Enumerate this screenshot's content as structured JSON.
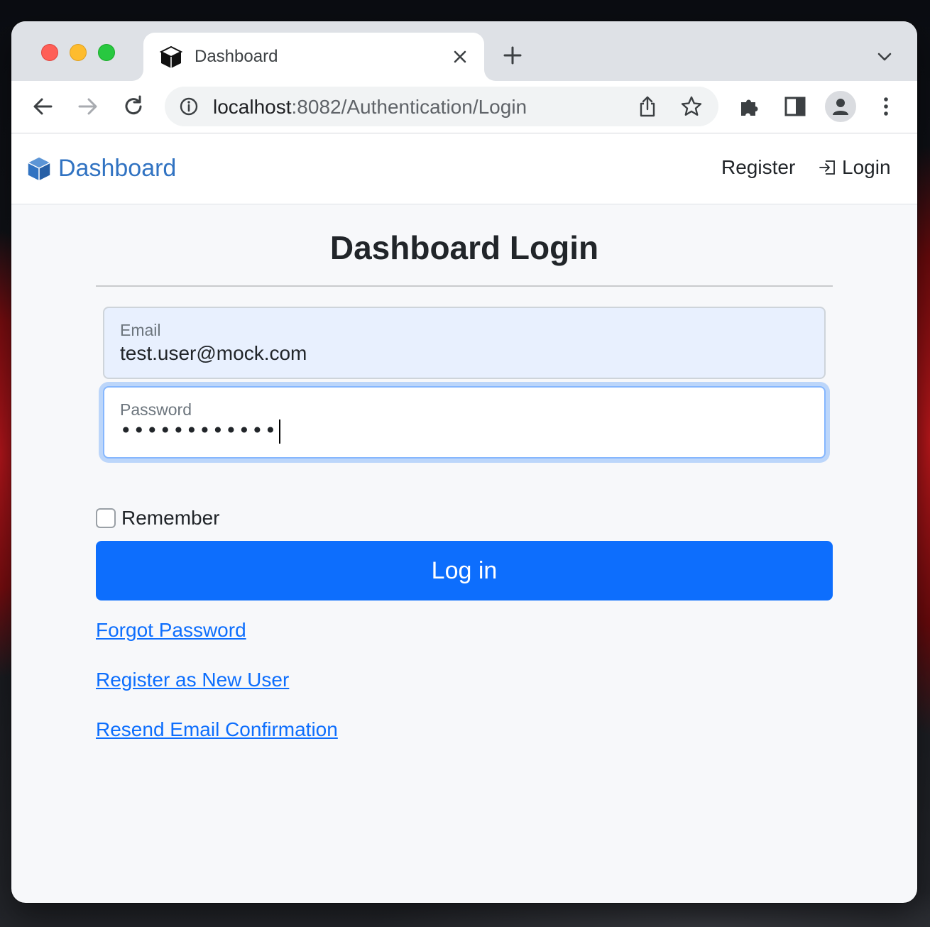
{
  "browser": {
    "tab": {
      "title": "Dashboard"
    },
    "omnibox": {
      "host": "localhost",
      "rest": ":8082/Authentication/Login"
    }
  },
  "navbar": {
    "brand": "Dashboard",
    "register": "Register",
    "login": "Login"
  },
  "login_form": {
    "title": "Dashboard Login",
    "email_label": "Email",
    "email_value": "test.user@mock.com",
    "password_label": "Password",
    "password_masked": "••••••••••••",
    "remember_label": "Remember",
    "submit_label": "Log in",
    "links": {
      "forgot": "Forgot Password",
      "register": "Register as New User",
      "resend": "Resend Email Confirmation"
    }
  },
  "colors": {
    "brand": "#3173c2",
    "primary": "#0d6efd",
    "autofill_bg": "#e8f0fe"
  },
  "icons": {
    "favicon": "box-icon",
    "close": "close-icon",
    "new_tab": "plus-icon",
    "back": "back-arrow-icon",
    "forward": "forward-arrow-icon",
    "reload": "reload-icon",
    "info": "info-icon",
    "share": "share-icon",
    "bookmark": "star-icon",
    "extensions": "puzzle-icon",
    "side_panel": "side-panel-icon",
    "profile": "profile-icon",
    "menu": "kebab-menu-icon",
    "login": "login-icon"
  }
}
